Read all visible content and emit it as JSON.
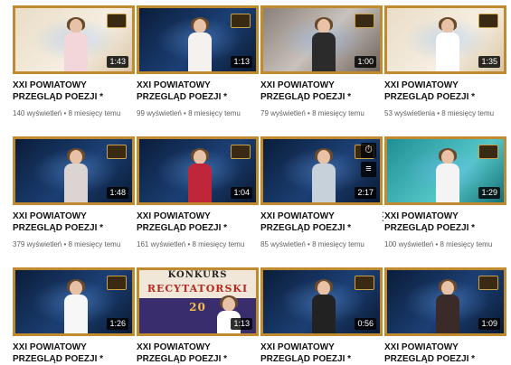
{
  "videos": [
    {
      "duration": "1:43",
      "title": "XXI POWIATOWY PRZEGLĄD POEZJI * ZŁOTE USTA *...",
      "views": "140 wyświetleń",
      "age": "8 miesięcy temu"
    },
    {
      "duration": "1:13",
      "title": "XXI POWIATOWY PRZEGLĄD POEZJI * ZŁOTE USTA *...",
      "views": "99 wyświetleń",
      "age": "8 miesięcy temu"
    },
    {
      "duration": "1:00",
      "title": "XXI POWIATOWY PRZEGLĄD POEZJI * ZŁOTE USTA *...",
      "views": "79 wyświetleń",
      "age": "8 miesięcy temu"
    },
    {
      "duration": "1:35",
      "title": "XXI POWIATOWY PRZEGLĄD POEZJI * ZŁOTE USTA *...",
      "views": "53 wyświetlenia",
      "age": "8 miesięcy temu"
    },
    {
      "duration": "1:48",
      "title": "XXI POWIATOWY PRZEGLĄD POEZJI * ZŁOTE USTA *...",
      "views": "379 wyświetleń",
      "age": "8 miesięcy temu"
    },
    {
      "duration": "1:04",
      "title": "XXI POWIATOWY PRZEGLĄD POEZJI * ZŁOTE USTA *...",
      "views": "161 wyświetleń",
      "age": "8 miesięcy temu"
    },
    {
      "duration": "2:17",
      "title": "XXI POWIATOWY PRZEGLĄD POEZJI * ZŁOTE USTA *...",
      "views": "85 wyświetleń",
      "age": "8 miesięcy temu"
    },
    {
      "duration": "1:29",
      "title": "XXI POWIATOWY PRZEGLĄD POEZJI * ZŁOTE USTA *...",
      "views": "100 wyświetleń",
      "age": "8 miesięcy temu"
    },
    {
      "duration": "1:26",
      "title": "XXI POWIATOWY PRZEGLĄD POEZJI * ZŁOTE USTA *...",
      "views": "",
      "age": ""
    },
    {
      "duration": "1:13",
      "title": "XXI POWIATOWY PRZEGLĄD POEZJI * ZŁOTE USTA *...",
      "views": "",
      "age": ""
    },
    {
      "duration": "0:56",
      "title": "XXI POWIATOWY PRZEGLĄD POEZJI * ZŁOTE USTA *...",
      "views": "",
      "age": ""
    },
    {
      "duration": "1:09",
      "title": "XXI POWIATOWY PRZEGLĄD POEZJI * ZŁOTE USTA *...",
      "views": "",
      "age": ""
    }
  ],
  "poster": {
    "line1": "KONKURS",
    "line2": "RECYTATORSKI",
    "line3": "20"
  },
  "overlay_icons": [
    "clock-icon",
    "queue-icon"
  ],
  "menu_icon": "more-vert-icon",
  "meta_separator": " • ",
  "colors": {
    "frame": "#c08a2e",
    "title": "#111111",
    "meta": "#606060"
  }
}
